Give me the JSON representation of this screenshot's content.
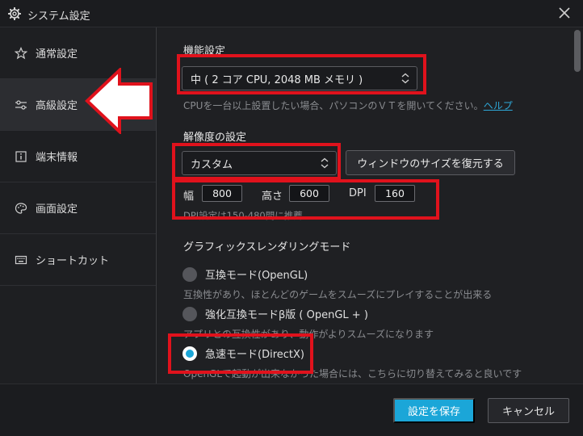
{
  "window": {
    "title": "システム設定"
  },
  "sidebar": {
    "items": [
      {
        "label": "通常設定",
        "icon": "star-icon"
      },
      {
        "label": "高級設定",
        "icon": "sliders-icon",
        "active": true
      },
      {
        "label": "端末情報",
        "icon": "info-icon"
      },
      {
        "label": "画面設定",
        "icon": "palette-icon"
      },
      {
        "label": "ショートカット",
        "icon": "keyboard-icon"
      }
    ]
  },
  "performance": {
    "title": "機能設定",
    "selected": "中 ( 2 コア CPU, 2048 MB メモリ )",
    "hint": "CPUを一台以上設置したい場合、パソコンのＶＴを開いてください。",
    "hint_link": "ヘルプ"
  },
  "resolution": {
    "title": "解像度の設定",
    "selected": "カスタム",
    "restore_button": "ウィンドウのサイズを復元する",
    "width_label": "幅",
    "width_value": "800",
    "height_label": "高さ",
    "height_value": "600",
    "dpi_label": "DPI",
    "dpi_value": "160",
    "hint": "DPI設定は150-480間に推薦"
  },
  "rendering": {
    "title": "グラフィックスレンダリングモード",
    "modes": [
      {
        "label": "互換モード(OpenGL)",
        "hint": "互換性があり、ほとんどのゲームをスムーズにプレイすることが出来る",
        "selected": false
      },
      {
        "label": "強化互換モードβ版 ( OpenGL + )",
        "hint": "アプリとの互換性があり、動作がよりスムーズになります",
        "selected": false
      },
      {
        "label": "急速モード(DirectX)",
        "hint": "OpenGLで起動が出来なかった場合には、こちらに切り替えてみると良いです",
        "selected": true
      }
    ]
  },
  "footer": {
    "save": "設定を保存",
    "cancel": "キャンセル"
  },
  "colors": {
    "accent": "#1ba6d8",
    "highlight_red": "#e0121c",
    "background": "#1f2023"
  }
}
